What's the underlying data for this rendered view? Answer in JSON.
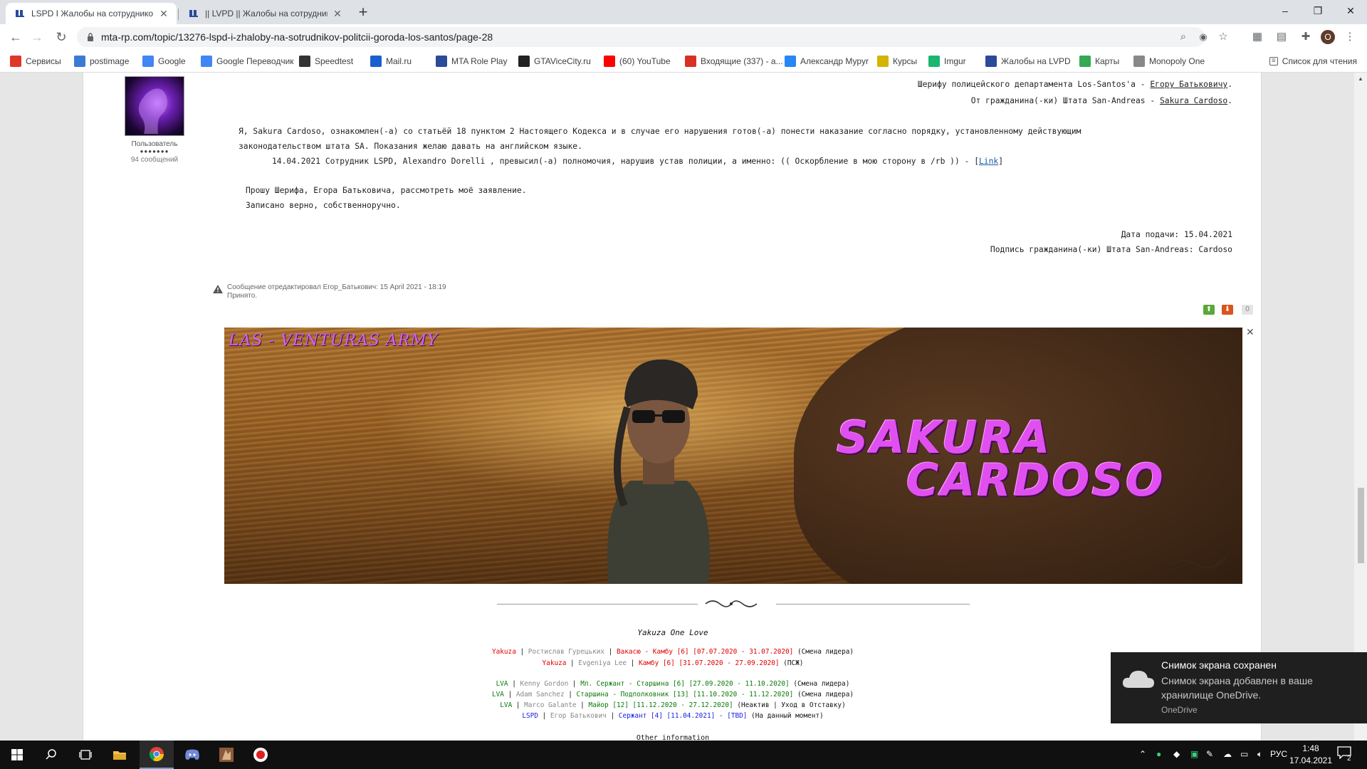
{
  "browser": {
    "tabs": [
      {
        "title": "LSPD I Жалобы на сотруднико",
        "active": true
      },
      {
        "title": "|| LVPD || Жалобы на сотрудник",
        "active": false
      }
    ],
    "new_tab": "+",
    "window_controls": {
      "minimize": "–",
      "maximize": "❐",
      "close": "✕"
    },
    "url": "mta-rp.com/topic/13276-lspd-i-zhaloby-na-sotrudnikov-politcii-goroda-los-santos/page-28"
  },
  "bookmarks": [
    {
      "label": "Сервисы",
      "icon": "apps-icon",
      "color": "#e0372b"
    },
    {
      "label": "postimage",
      "icon": "postimage-icon",
      "color": "#3b7bd4"
    },
    {
      "label": "Google",
      "icon": "google-icon",
      "color": "#4285f4"
    },
    {
      "label": "Google Переводчик",
      "icon": "translate-icon",
      "color": "#4285f4"
    },
    {
      "label": "Speedtest",
      "icon": "speedtest-icon",
      "color": "#333333"
    },
    {
      "label": "Mail.ru",
      "icon": "mailru-icon",
      "color": "#1a5fcf"
    },
    {
      "label": "MTA Role Play",
      "icon": "mta-icon",
      "color": "#2a4a9a"
    },
    {
      "label": "GTAViceCity.ru",
      "icon": "gtavc-icon",
      "color": "#222222"
    },
    {
      "label": "(60) YouTube",
      "icon": "youtube-icon",
      "color": "#ff0000"
    },
    {
      "label": "Входящие (337) - a...",
      "icon": "gmail-icon",
      "color": "#d93025"
    },
    {
      "label": "Александр Мурyr",
      "icon": "vk-icon",
      "color": "#2787f5"
    },
    {
      "label": "Курсы",
      "icon": "courses-icon",
      "color": "#d4b400"
    },
    {
      "label": "Imgur",
      "icon": "imgur-icon",
      "color": "#1bb76e"
    },
    {
      "label": "Жалобы на LVPD",
      "icon": "mta-icon",
      "color": "#2a4a9a"
    },
    {
      "label": "Карты",
      "icon": "maps-icon",
      "color": "#34a853"
    },
    {
      "label": "Monopoly One",
      "icon": "monopoly-icon",
      "color": "#888888"
    }
  ],
  "reading_list": "Список для чтения",
  "post": {
    "author": {
      "group": "Пользователь",
      "pips": "●●●●●●●",
      "posts": "94 сообщений"
    },
    "header": [
      {
        "text": "Шерифу полицейского департамента Los-Santos'a - ",
        "underlined": "Егору Батьковичу",
        "tail": "."
      },
      {
        "text": "От гражданина(-ки) Штата San-Andreas - ",
        "underlined": "Sakura Cardoso",
        "tail": "."
      }
    ],
    "body_line1": "Я, Sakura Cardoso, ознакомлен(-а) со статьёй 18 пунктом 2 Настоящего Кодекса и в случае его нарушения готов(-а) понести наказание согласно порядку, установленному действующим",
    "body_line2": "законодательством штата SA. Показания желаю давать на английском языке.",
    "complaint_prefix": "14.04.2021 Сотрудник LSPD, Alexandro Dorelli , превысил(-а) полномочия, нарушив устав полиции, а именно: (( Оскорбление в мою сторону в /rb )) - [",
    "complaint_link": "Link",
    "complaint_suffix": "]",
    "request": "Прошу Шерифа, Егора Батьковича, рассмотреть моё заявление.",
    "recorded": "Записано верно, собственноручно.",
    "date": "Дата подачи: 15.04.2021",
    "signature": "Подпись гражданина(-ки) Штата San-Andreas: Cardoso",
    "edit_note": "Сообщение отредактировал Егор_Батькович: 15 April 2021 - 18:19",
    "edit_comment": "Принято.",
    "rating": {
      "up": "⬆",
      "down": "⬇",
      "count": "0"
    }
  },
  "banner": {
    "title": "LAS - VENTURAS ARMY",
    "name_line1": "SAKURA",
    "name_line2": "CARDOSO",
    "close": "✕"
  },
  "signature_block": {
    "title": "Yakuza One Love",
    "rows": [
      [
        {
          "t": "Yakuza",
          "c": "c-red"
        },
        {
          "t": " | ",
          "c": ""
        },
        {
          "t": "Ростислав Гурецьких",
          "c": "c-grey"
        },
        {
          "t": " | ",
          "c": ""
        },
        {
          "t": "Вакасю - Камбу [6] [07.07.2020 - 31.07.2020]",
          "c": "c-red"
        },
        {
          "t": " (Смена лидера)",
          "c": ""
        }
      ],
      [
        {
          "t": "Yakuza",
          "c": "c-red"
        },
        {
          "t": " | ",
          "c": ""
        },
        {
          "t": "Evgeniya Lee",
          "c": "c-grey"
        },
        {
          "t": " | ",
          "c": ""
        },
        {
          "t": "Камбу [6] [31.07.2020 - 27.09.2020]",
          "c": "c-red"
        },
        {
          "t": " (ПСЖ)",
          "c": ""
        }
      ],
      [
        {
          "t": "LVA",
          "c": "c-green"
        },
        {
          "t": " | ",
          "c": ""
        },
        {
          "t": "Kenny Gordon",
          "c": "c-grey"
        },
        {
          "t": " | ",
          "c": ""
        },
        {
          "t": "Мл. Сержант - Старшина [6] [27.09.2020 - 11.10.2020]",
          "c": "c-green"
        },
        {
          "t": " (Смена лидера)",
          "c": ""
        }
      ],
      [
        {
          "t": "LVA",
          "c": "c-green"
        },
        {
          "t": " | ",
          "c": ""
        },
        {
          "t": "Adam Sanchez",
          "c": "c-grey"
        },
        {
          "t": " | ",
          "c": ""
        },
        {
          "t": "Старшина - Подполковник [13] [11.10.2020 - 11.12.2020]",
          "c": "c-green"
        },
        {
          "t": " (Смена лидера)",
          "c": ""
        }
      ],
      [
        {
          "t": "LVA",
          "c": "c-green"
        },
        {
          "t": " | ",
          "c": ""
        },
        {
          "t": "Marco Galante",
          "c": "c-grey"
        },
        {
          "t": " | ",
          "c": ""
        },
        {
          "t": "Майор [12] [11.12.2020 - 27.12.2020]",
          "c": "c-green"
        },
        {
          "t": " (Неактив | Уход в Отставку)",
          "c": ""
        }
      ],
      [
        {
          "t": "LSPD",
          "c": "c-blue"
        },
        {
          "t": " | ",
          "c": ""
        },
        {
          "t": "Егор Батькович",
          "c": "c-grey"
        },
        {
          "t": " | ",
          "c": ""
        },
        {
          "t": "Сержант [4] [11.04.2021] - [TBD]",
          "c": "c-blue"
        },
        {
          "t": " (На данный момент)",
          "c": ""
        }
      ]
    ],
    "other": "Other information"
  },
  "toast": {
    "title": "Снимок экрана сохранен",
    "body": "Снимок экрана добавлен в ваше хранилище OneDrive.",
    "source": "OneDrive"
  },
  "taskbar": {
    "language": "РУС",
    "time": "1:48",
    "date": "17.04.2021",
    "notifications": "2"
  }
}
